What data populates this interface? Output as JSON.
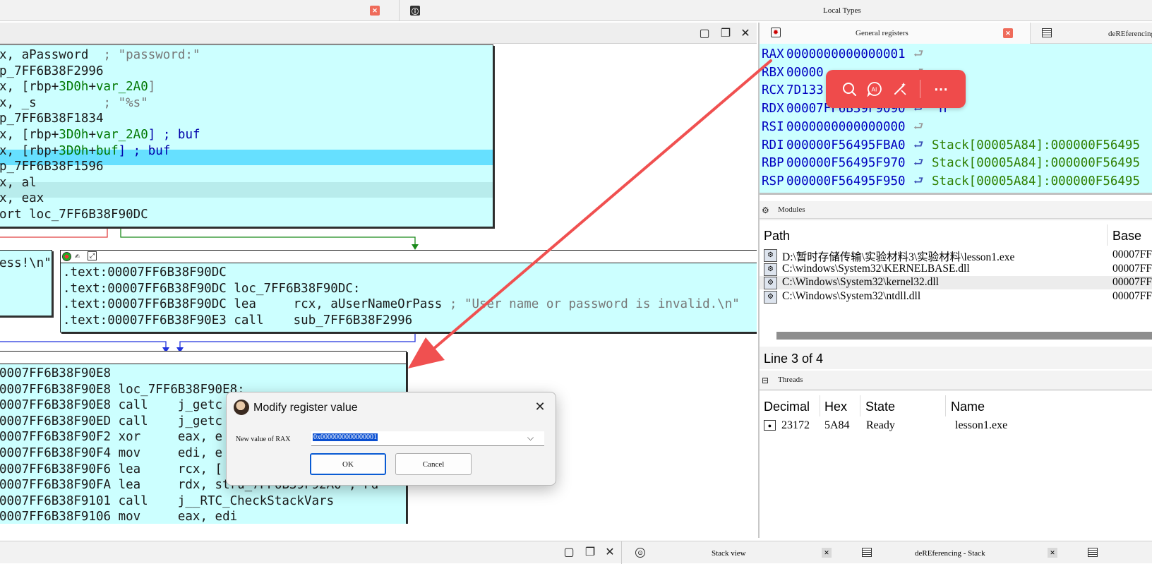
{
  "top_tabs": {
    "local_types": "Local Types",
    "general_registers": "General registers",
    "dereferencing": "deREferencing"
  },
  "graph": {
    "block1_lines": [
      {
        "pre": "x, aPassword  ",
        "post": "; \"password:\""
      },
      {
        "pre": "p_7FF6B38F2996",
        "post": ""
      },
      {
        "pre": "x, [rbp+",
        "green": "3D0h",
        "pre2": "+",
        "green2": "var_2A0",
        "post": "]"
      },
      {
        "pre": "x, _s         ",
        "post": "; \"%s\""
      },
      {
        "pre": "p_7FF6B38F1834",
        "post": ""
      },
      {
        "pre": "x, [rbp+",
        "green": "3D0h",
        "pre2": "+",
        "green2": "var_2A0",
        "post": "] ; buf"
      },
      {
        "pre": "x, [rbp+",
        "green": "3D0h",
        "pre2": "+",
        "green2": "buf",
        "post": "] ; buf"
      },
      {
        "pre": "p_7FF6B38F1596",
        "post": ""
      },
      {
        "pre": "x, al",
        "post": ""
      },
      {
        "pre": "x, eax",
        "post": ""
      },
      {
        "pre": "ort loc_7FF6B38F90DC",
        "post": ""
      }
    ],
    "left_stub_text": "ess!\\n\"",
    "block2_lines": [
      {
        "addr": ".text:00007FF6B38F90DC",
        "rest": ""
      },
      {
        "addr": ".text:00007FF6B38F90DC",
        "rest": " loc_7FF6B38F90DC:"
      },
      {
        "addr": ".text:00007FF6B38F90DC",
        "rest": " lea     rcx, aUserNameOrPass",
        "cmt": " ; \"User name or password is invalid.\\n\""
      },
      {
        "addr": ".text:00007FF6B38F90E3",
        "rest": " call    sub_7FF6B38F2996"
      }
    ],
    "block3_lines": [
      "0007FF6B38F90E8",
      "0007FF6B38F90E8 loc_7FF6B38F90E8:",
      "0007FF6B38F90E8 call    j_getc",
      "0007FF6B38F90ED call    j_getc",
      "0007FF6B38F90F2 xor     eax, e",
      "0007FF6B38F90F4 mov     edi, e",
      "0007FF6B38F90F6 lea     rcx, [",
      "0007FF6B38F90FA lea     rdx, stru_7FF6B39F92A0 ; Fd",
      "0007FF6B38F9101 call    j__RTC_CheckStackVars",
      "0007FF6B38F9106 mov     eax, edi"
    ]
  },
  "registers": [
    {
      "name": "RAX",
      "value": "0000000000000001",
      "comment": ""
    },
    {
      "name": "RBX",
      "value": "00000",
      "comment": ""
    },
    {
      "name": "RCX",
      "value": "7D133",
      "comment": ""
    },
    {
      "name": "RDX",
      "value": "00007FF6B39F9090",
      "comment": "\"H\""
    },
    {
      "name": "RSI",
      "value": "0000000000000000",
      "comment": ""
    },
    {
      "name": "RDI",
      "value": "000000F56495FBA0",
      "comment": "Stack[00005A84]:000000F56495"
    },
    {
      "name": "RBP",
      "value": "000000F56495F970",
      "comment": "Stack[00005A84]:000000F56495"
    },
    {
      "name": "RSP",
      "value": "000000F56495F950",
      "comment": "Stack[00005A84]:000000F56495"
    }
  ],
  "modules": {
    "title": "Modules",
    "col_path": "Path",
    "col_base": "Base",
    "rows": [
      {
        "path": "D:\\暂时存储传输\\实验材料3\\实验材料\\lesson1.exe",
        "base": "00007FF"
      },
      {
        "path": "C:\\windows\\System32\\KERNELBASE.dll",
        "base": "00007FF"
      },
      {
        "path": "C:\\Windows\\System32\\kernel32.dll",
        "base": "00007FF"
      },
      {
        "path": "C:\\Windows\\System32\\ntdll.dll",
        "base": "00007FF"
      }
    ],
    "status": "Line 3 of 4"
  },
  "threads": {
    "title": "Threads",
    "columns": [
      "Decimal",
      "Hex",
      "State",
      "Name"
    ],
    "rows": [
      {
        "decimal": "23172",
        "hex": "5A84",
        "state": "Ready",
        "name": "lesson1.exe"
      }
    ]
  },
  "dialog": {
    "title": "Modify register value",
    "label": "New value of RAX",
    "value": "0x0000000000000001",
    "ok": "OK",
    "cancel": "Cancel"
  },
  "bottom_tabs": {
    "stack_view": "Stack view",
    "deref_stack": "deREferencing - Stack"
  },
  "colors": {
    "block_bg": "#ccffff",
    "highlight": "#66e0ff",
    "toolbar": "#ef4b4b",
    "arrow": "#f05050"
  }
}
